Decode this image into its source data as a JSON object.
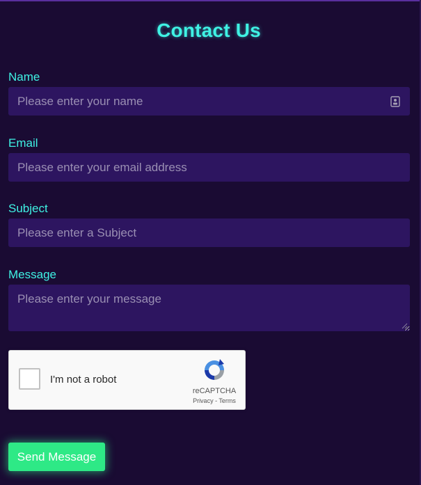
{
  "form": {
    "title": "Contact Us",
    "name": {
      "label": "Name",
      "placeholder": "Please enter your name",
      "value": ""
    },
    "email": {
      "label": "Email",
      "placeholder": "Please enter your email address",
      "value": ""
    },
    "subject": {
      "label": "Subject",
      "placeholder": "Please enter a Subject",
      "value": ""
    },
    "message": {
      "label": "Message",
      "placeholder": "Please enter your message",
      "value": ""
    },
    "recaptcha": {
      "checkbox_label": "I'm not a robot",
      "brand": "reCAPTCHA",
      "privacy_link": "Privacy",
      "separator": " - ",
      "terms_link": "Terms",
      "checked": false
    },
    "submit_label": "Send Message"
  },
  "colors": {
    "background": "#1a0b33",
    "field_background": "#2d1560",
    "accent_cyan": "#3ff2e4",
    "button_green": "#2ee986"
  },
  "icons": {
    "name_field_icon": "contact-card-icon",
    "recaptcha_logo": "recaptcha-logo-icon"
  }
}
